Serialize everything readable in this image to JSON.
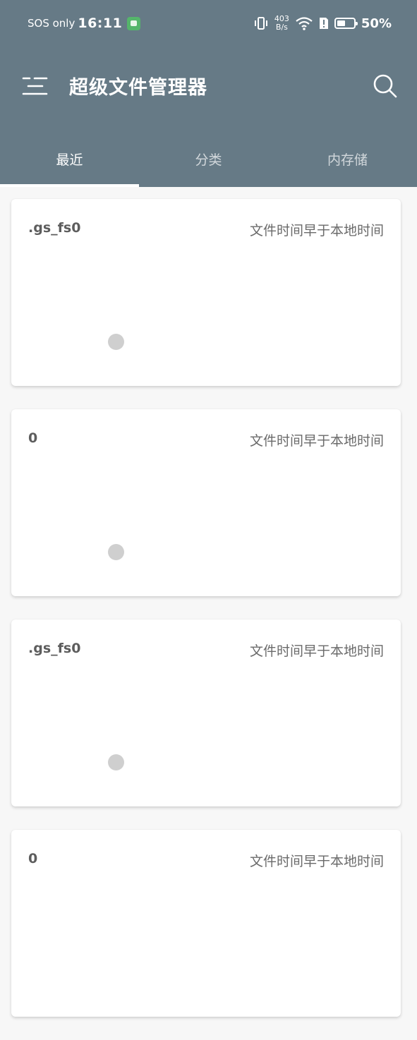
{
  "status_bar": {
    "carrier": "SOS only",
    "time": "16:11",
    "net_speed_value": "403",
    "net_speed_unit": "B/s",
    "battery": "50%"
  },
  "app_bar": {
    "title": "超级文件管理器",
    "menu_icon": "menu-icon",
    "search_icon": "search-icon"
  },
  "tabs": [
    {
      "label": "最近",
      "active": true
    },
    {
      "label": "分类",
      "active": false
    },
    {
      "label": "内存储",
      "active": false
    }
  ],
  "files": [
    {
      "name": ".gs_fs0",
      "note": "文件时间早于本地时间"
    },
    {
      "name": "0",
      "note": "文件时间早于本地时间"
    },
    {
      "name": ".gs_fs0",
      "note": "文件时间早于本地时间"
    },
    {
      "name": "0",
      "note": "文件时间早于本地时间"
    }
  ],
  "colors": {
    "header": "#667a86",
    "background": "#f7f7f7",
    "card": "#ffffff"
  }
}
